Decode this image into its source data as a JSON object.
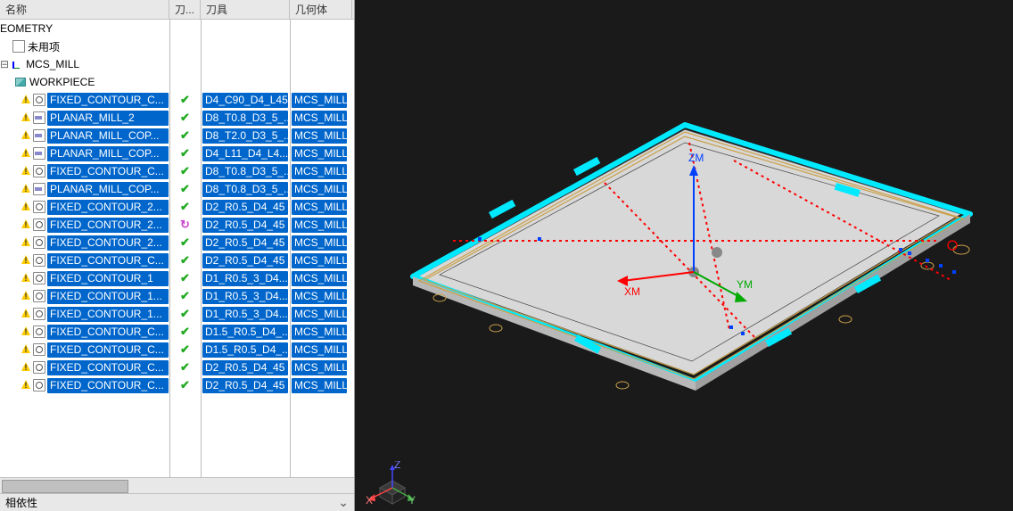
{
  "headers": {
    "name": "名称",
    "status": "刀...",
    "tool": "刀具",
    "geom": "几何体"
  },
  "footer": {
    "label": "相依性"
  },
  "tree": {
    "geometry": "EOMETRY",
    "unused": "未用项",
    "mcs": "MCS_MILL",
    "workpiece": "WORKPIECE"
  },
  "ops": [
    {
      "name": "FIXED_CONTOUR_C...",
      "type": "fixed",
      "tool": "D4_C90_D4_L45",
      "geom": "MCS_MILL",
      "status": "check"
    },
    {
      "name": "PLANAR_MILL_2",
      "type": "planar",
      "tool": "D8_T0.8_D3_5_...",
      "geom": "MCS_MILL",
      "status": "check"
    },
    {
      "name": "PLANAR_MILL_COP...",
      "type": "planar",
      "tool": "D8_T2.0_D3_5_...",
      "geom": "MCS_MILL",
      "status": "check"
    },
    {
      "name": "PLANAR_MILL_COP...",
      "type": "planar",
      "tool": "D4_L11_D4_L4...",
      "geom": "MCS_MILL",
      "status": "check"
    },
    {
      "name": "FIXED_CONTOUR_C...",
      "type": "fixed",
      "tool": "D8_T0.8_D3_5_...",
      "geom": "MCS_MILL",
      "status": "check"
    },
    {
      "name": "PLANAR_MILL_COP...",
      "type": "planar",
      "tool": "D8_T0.8_D3_5_...",
      "geom": "MCS_MILL",
      "status": "check"
    },
    {
      "name": "FIXED_CONTOUR_2...",
      "type": "fixed",
      "tool": "D2_R0.5_D4_45",
      "geom": "MCS_MILL",
      "status": "check"
    },
    {
      "name": "FIXED_CONTOUR_2...",
      "type": "fixed",
      "tool": "D2_R0.5_D4_45",
      "geom": "MCS_MILL",
      "status": "arrow"
    },
    {
      "name": "FIXED_CONTOUR_2...",
      "type": "fixed",
      "tool": "D2_R0.5_D4_45",
      "geom": "MCS_MILL",
      "status": "check"
    },
    {
      "name": "FIXED_CONTOUR_C...",
      "type": "fixed",
      "tool": "D2_R0.5_D4_45",
      "geom": "MCS_MILL",
      "status": "check"
    },
    {
      "name": "FIXED_CONTOUR_1",
      "type": "fixed",
      "tool": "D1_R0.5_3_D4...",
      "geom": "MCS_MILL",
      "status": "check"
    },
    {
      "name": "FIXED_CONTOUR_1...",
      "type": "fixed",
      "tool": "D1_R0.5_3_D4...",
      "geom": "MCS_MILL",
      "status": "check"
    },
    {
      "name": "FIXED_CONTOUR_1...",
      "type": "fixed",
      "tool": "D1_R0.5_3_D4...",
      "geom": "MCS_MILL",
      "status": "check"
    },
    {
      "name": "FIXED_CONTOUR_C...",
      "type": "fixed",
      "tool": "D1.5_R0.5_D4_...",
      "geom": "MCS_MILL",
      "status": "check"
    },
    {
      "name": "FIXED_CONTOUR_C...",
      "type": "fixed",
      "tool": "D1.5_R0.5_D4_...",
      "geom": "MCS_MILL",
      "status": "check"
    },
    {
      "name": "FIXED_CONTOUR_C...",
      "type": "fixed",
      "tool": "D2_R0.5_D4_45",
      "geom": "MCS_MILL",
      "status": "check"
    },
    {
      "name": "FIXED_CONTOUR_C...",
      "type": "fixed",
      "tool": "D2_R0.5_D4_45",
      "geom": "MCS_MILL",
      "status": "check"
    }
  ],
  "axis_labels": {
    "x": "XM",
    "y": "YM",
    "z": "ZM"
  },
  "triad_labels": {
    "x": "X",
    "y": "Y",
    "z": "Z"
  }
}
